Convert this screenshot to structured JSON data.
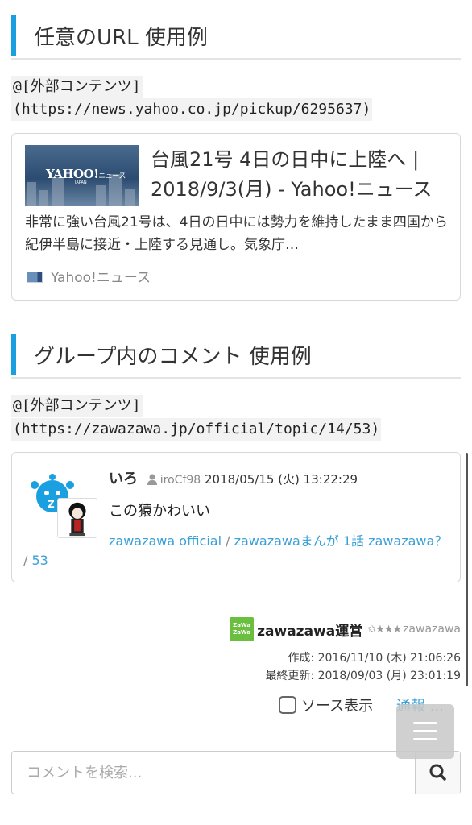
{
  "url_section": {
    "heading": "任意のURL 使用例",
    "code_line1": "@[外部コンテンツ]",
    "code_line2": "(https://news.yahoo.co.jp/pickup/6295637)",
    "card": {
      "thumb_logo": "YAHOO!",
      "thumb_logo_suffix": "ニュース",
      "thumb_sub": "JAPAN",
      "title": "台風21号 4日の日中に上陸へ | 2018/9/3(月) - Yahoo!ニュース",
      "description": "非常に強い台風21号は、4日の日中には勢力を維持したまま四国から紀伊半島に接近・上陸する見通し。気象庁…",
      "source": "Yahoo!ニュース"
    }
  },
  "comment_section": {
    "heading": "グループ内のコメント 使用例",
    "code_line1": "@[外部コンテンツ]",
    "code_line2": "(https://zawazawa.jp/official/topic/14/53)",
    "comment": {
      "username": "いろ",
      "user_id": "iroCf98",
      "datetime": "2018/05/15 (火) 13:22:29",
      "body": "この猿かわいい",
      "breadcrumb": [
        "zawazawa official",
        "zawazawaまんが 1話 zawazawa？",
        "53"
      ],
      "separator": " / "
    }
  },
  "author": {
    "logo_text_1": "ZaWa",
    "logo_text_2": "ZaWa",
    "name": "zawazawa運営",
    "stars": "✩★★★",
    "org": "zawazawa",
    "created": "作成: 2016/11/10 (木) 21:06:26",
    "updated": "最終更新: 2018/09/03 (月) 23:01:19"
  },
  "controls": {
    "source_toggle_label": "ソース表示",
    "report_label": "通報 ...",
    "search_placeholder": "コメントを検索..."
  },
  "colors": {
    "accent": "#1a9fe0",
    "link": "#3aa0d8",
    "author_logo": "#6bbf3f"
  },
  "icons": [
    "source-icon",
    "user-icon",
    "search-icon",
    "menu-icon",
    "checkbox"
  ]
}
